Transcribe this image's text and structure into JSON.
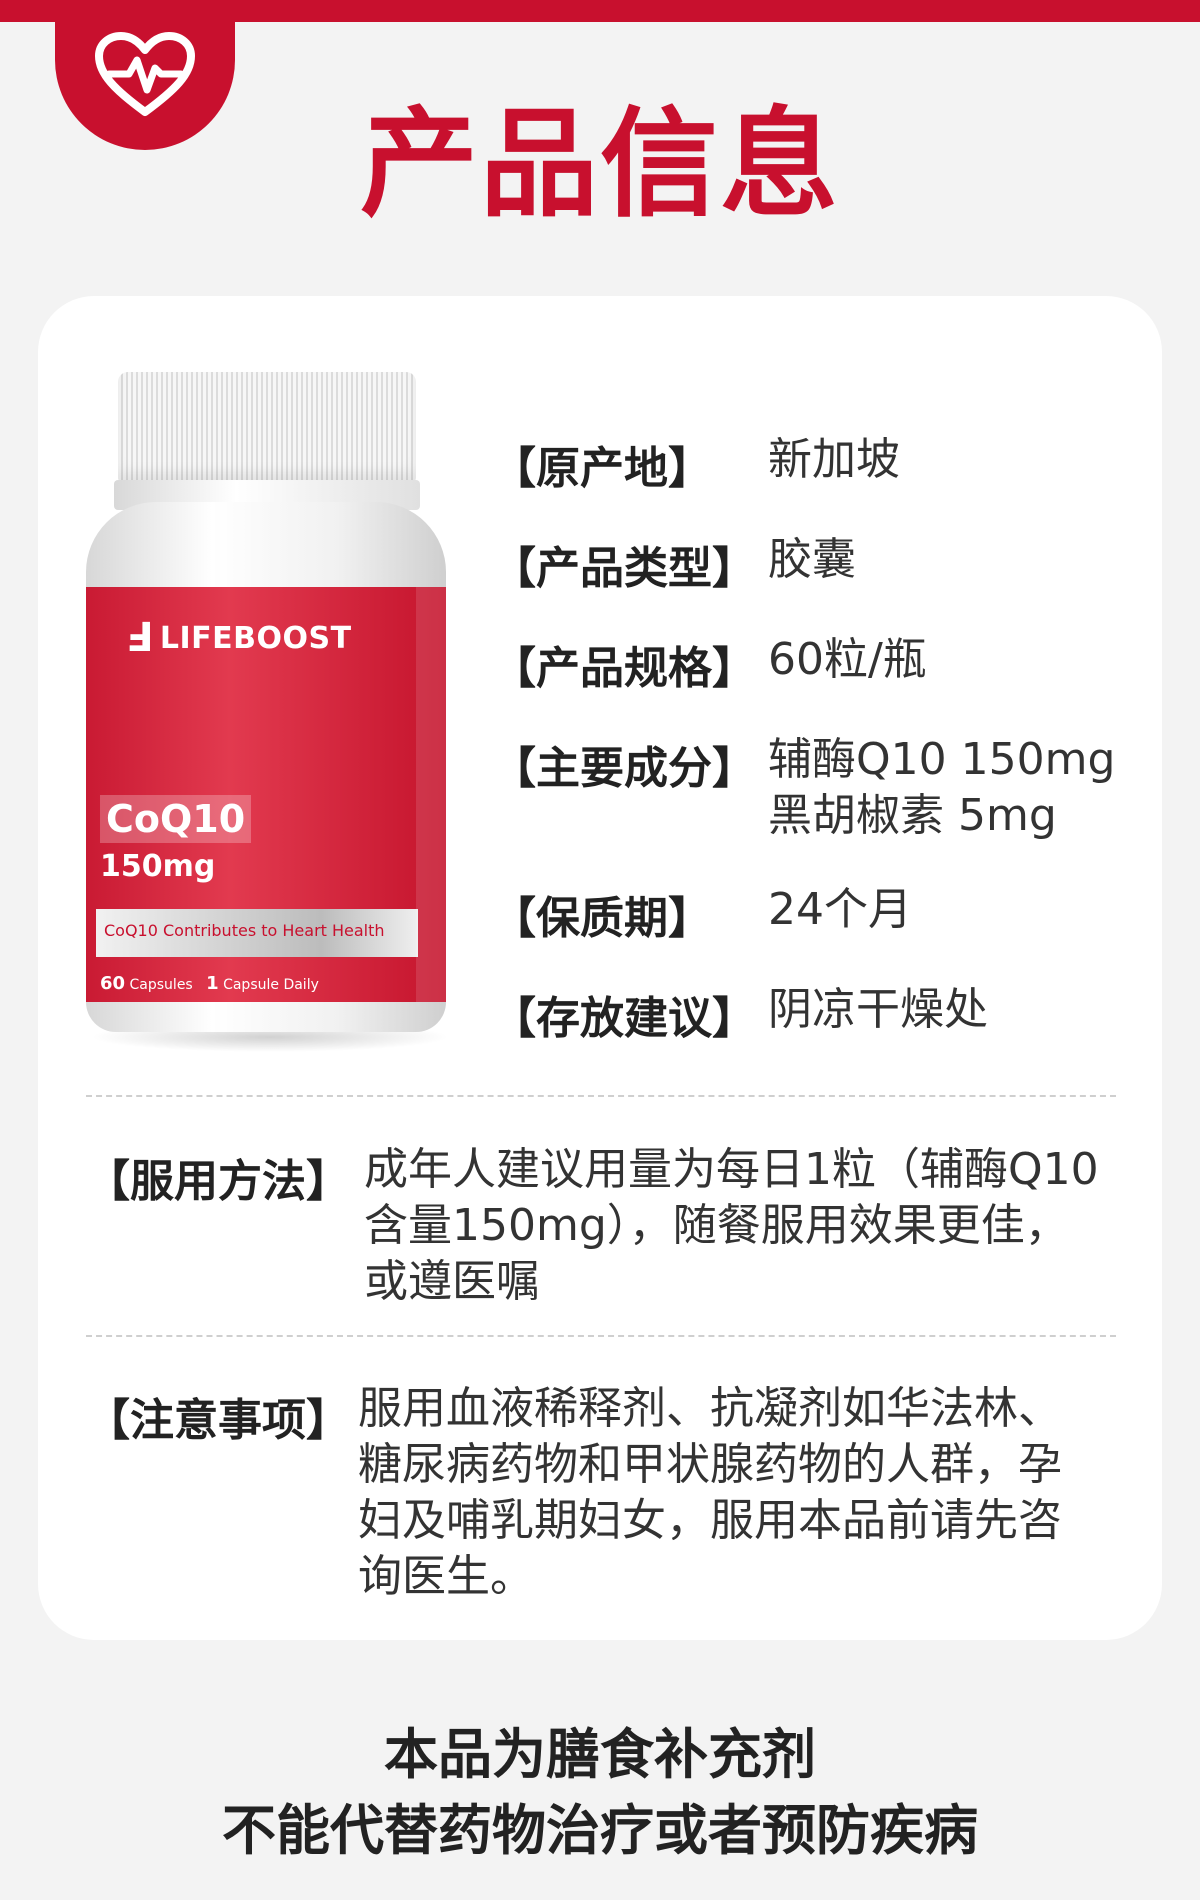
{
  "header": {
    "title": "产品信息",
    "accent_color": "#c8102e",
    "badge_icon": "heart-pulse-icon"
  },
  "product_image": {
    "brand": "LIFEBOOST",
    "product_name": "CoQ10",
    "dose": "150mg",
    "tagline": "CoQ10 Contributes to Heart Health",
    "capsule_count": "60",
    "capsule_count_label": "Capsules",
    "daily_count": "1",
    "daily_label": "Capsule Daily"
  },
  "info": [
    {
      "key": "【原产地】",
      "lines": [
        "新加坡"
      ]
    },
    {
      "key": "【产品类型】",
      "lines": [
        "胶囊"
      ]
    },
    {
      "key": "【产品规格】",
      "lines": [
        "60粒/瓶"
      ]
    },
    {
      "key": "【主要成分】",
      "lines": [
        "辅酶Q10  150mg",
        "黑胡椒素  5mg"
      ]
    },
    {
      "key": "【保质期】",
      "lines": [
        "24个月"
      ]
    },
    {
      "key": "【存放建议】",
      "lines": [
        "阴凉干燥处"
      ]
    }
  ],
  "usage": {
    "key": "【服用方法】",
    "lines": [
      "成年人建议用量为每日1粒（辅酶Q10",
      "含量150mg），随餐服用效果更佳，",
      "或遵医嘱"
    ]
  },
  "caution": {
    "key": "【注意事项】",
    "lines": [
      "服用血液稀释剂、抗凝剂如华法林、",
      "糖尿病药物和甲状腺药物的人群，孕",
      "妇及哺乳期妇女，服用本品前请先咨",
      "询医生。"
    ]
  },
  "disclaimer": {
    "line1": "本品为膳食补充剂",
    "line2": "不能代替药物治疗或者预防疾病"
  }
}
